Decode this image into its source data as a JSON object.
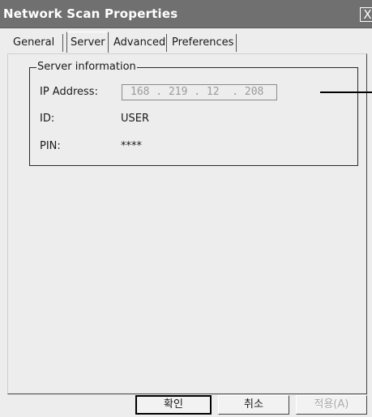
{
  "window": {
    "title": "Network Scan Properties",
    "close_glyph": "X"
  },
  "tabs": [
    {
      "label": "General",
      "active": false
    },
    {
      "label": "Server",
      "active": true
    },
    {
      "label": "Advanced",
      "active": false
    },
    {
      "label": "Preferences",
      "active": false
    }
  ],
  "server_info": {
    "group_title": "Server information",
    "ip_label": "IP Address:",
    "ip_value": "168 . 219 . 12  . 208",
    "id_label": "ID:",
    "id_value": "USER",
    "pin_label": "PIN:",
    "pin_value": "****"
  },
  "buttons": {
    "ok": "확인",
    "cancel": "취소",
    "apply": "적용(A)"
  },
  "colors": {
    "titlebar": "#707070",
    "window_bg": "#ededed",
    "disabled_text": "#a8a8a8"
  }
}
